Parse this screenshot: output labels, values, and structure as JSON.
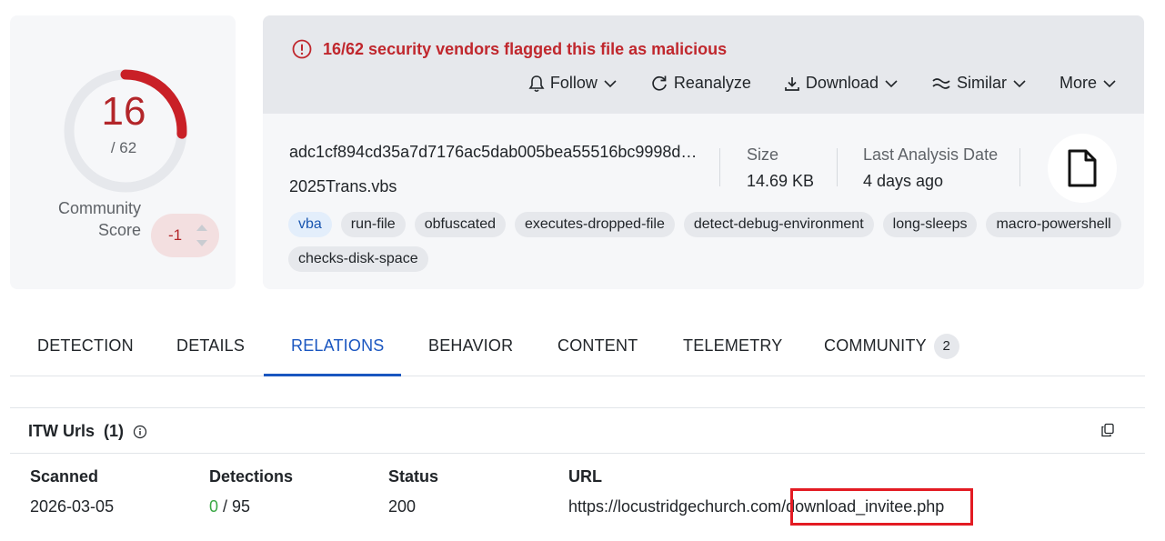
{
  "score": {
    "detections": "16",
    "total": "/ 62",
    "fraction": 0.258,
    "community_label": "Community\nScore",
    "community_value": "-1"
  },
  "alert": {
    "text": "16/62 security vendors flagged this file as malicious",
    "color": "#c0272d"
  },
  "actions": {
    "follow": "Follow",
    "reanalyze": "Reanalyze",
    "download": "Download",
    "similar": "Similar",
    "more": "More"
  },
  "file": {
    "hash": "adc1cf894cd35a7d7176ac5dab005bea55516bc9998d…",
    "name": "2025Trans.vbs",
    "size_label": "Size",
    "size_value": "14.69 KB",
    "date_label": "Last Analysis Date",
    "date_value": "4 days ago",
    "icon": "file-icon"
  },
  "tags": [
    "vba",
    "run-file",
    "obfuscated",
    "executes-dropped-file",
    "detect-debug-environment",
    "long-sleeps",
    "macro-powershell",
    "checks-disk-space"
  ],
  "tabs": {
    "detection": "DETECTION",
    "details": "DETAILS",
    "relations": "RELATIONS",
    "behavior": "BEHAVIOR",
    "content": "CONTENT",
    "telemetry": "TELEMETRY",
    "community": "COMMUNITY",
    "community_count": "2",
    "active": "RELATIONS"
  },
  "itw": {
    "title": "ITW Urls",
    "count": "(1)",
    "headers": {
      "scanned": "Scanned",
      "detections": "Detections",
      "status": "Status",
      "url": "URL"
    },
    "row": {
      "scanned": "2026-03-05",
      "detections_positive": "0",
      "detections_total": " / 95",
      "status": "200",
      "url_base": "https://locustridgechurch.com/",
      "url_path": "download_invitee.php"
    }
  },
  "colors": {
    "accent_blue": "#1a56c0",
    "malicious_red": "#c0272d",
    "highlight_red": "#e31b23",
    "clean_green": "#3aa845"
  }
}
